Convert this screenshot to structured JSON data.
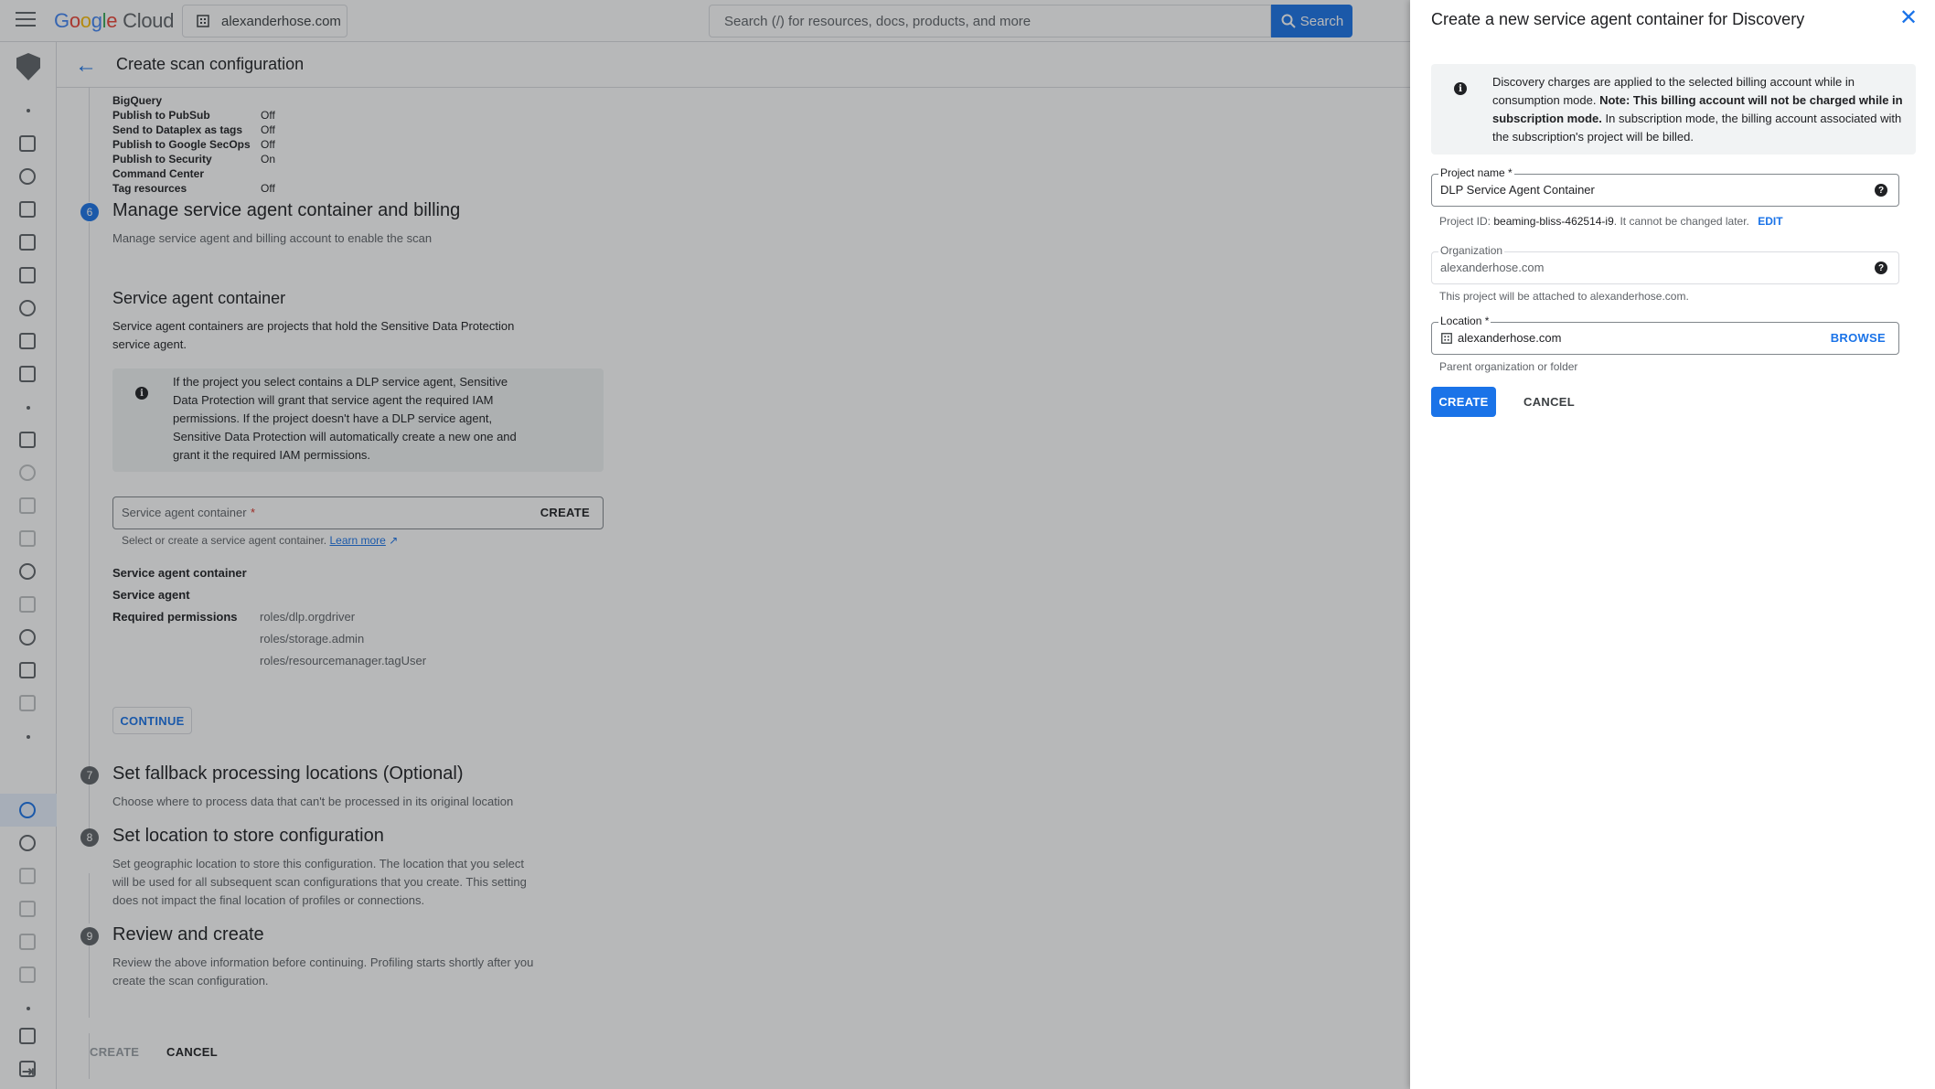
{
  "topbar": {
    "logo_letters": [
      "G",
      "o",
      "o",
      "g",
      "l",
      "e"
    ],
    "logo_cloud": "Cloud",
    "project": "alexanderhose.com",
    "search_placeholder": "Search (/) for resources, docs, products, and more",
    "search_button": "Search"
  },
  "subheader": {
    "title": "Create scan configuration"
  },
  "summary": {
    "partial_label": "BigQuery",
    "rows": [
      {
        "label": "Publish to PubSub",
        "value": "Off"
      },
      {
        "label": "Send to Dataplex as tags",
        "value": "Off"
      },
      {
        "label": "Publish to Google SecOps",
        "value": "Off"
      },
      {
        "label": "Publish to Security",
        "value": "On"
      },
      {
        "label": "Command Center",
        "value": ""
      },
      {
        "label": "Tag resources",
        "value": "Off"
      }
    ]
  },
  "step6": {
    "num": "6",
    "title": "Manage service agent container and billing",
    "desc": "Manage service agent and billing account to enable the scan",
    "section_title": "Service agent container",
    "section_text_1": "Service agent containers are projects that hold the Sensitive Data Protection",
    "section_text_2": "service agent.",
    "info_lines": [
      "If the project you select contains a DLP service agent, Sensitive",
      "Data Protection will grant that service agent the required IAM",
      "permissions. If the project doesn't have a DLP service agent,",
      "Sensitive Data Protection will automatically create a new one and",
      "grant it the required IAM permissions."
    ],
    "field_placeholder": "Service agent container",
    "field_required": "*",
    "field_create": "CREATE",
    "hint_text": "Select or create a service agent container.",
    "learn_more": "Learn more",
    "details": {
      "container_label": "Service agent container",
      "agent_label": "Service agent",
      "permissions_label": "Required permissions",
      "permissions": [
        "roles/dlp.orgdriver",
        "roles/storage.admin",
        "roles/resourcemanager.tagUser"
      ]
    },
    "continue": "CONTINUE"
  },
  "step7": {
    "num": "7",
    "title": "Set fallback processing locations (Optional)",
    "desc": "Choose where to process data that can't be processed in its original location"
  },
  "step8": {
    "num": "8",
    "title": "Set location to store configuration",
    "desc_lines": [
      "Set geographic location to store this configuration. The location that you select",
      "will be used for all subsequent scan configurations that you create. This setting",
      "does not impact the final location of profiles or connections."
    ]
  },
  "step9": {
    "num": "9",
    "title": "Review and create",
    "desc_lines": [
      "Review the above information before continuing. Profiling starts shortly after you",
      "create the scan configuration."
    ]
  },
  "footer": {
    "create": "CREATE",
    "cancel": "CANCEL"
  },
  "panel": {
    "title": "Create a new service agent container for Discovery",
    "info_lines": [
      {
        "plain": "Discovery charges are applied to the selected billing account while in",
        "bold": ""
      },
      {
        "plain": "consumption mode. ",
        "bold": "Note: This billing account will not be charged while in"
      },
      {
        "plain": " In subscription mode, the billing account associated with",
        "bold": "subscription mode.",
        "bold_first": true
      },
      {
        "plain": "the subscription's project will be billed.",
        "bold": ""
      }
    ],
    "project_name_label": "Project name *",
    "project_name_value": "DLP Service Agent Container",
    "project_id_prefix": "Project ID:",
    "project_id": "beaming-bliss-462514-i9",
    "project_id_suffix": ". It cannot be changed later.",
    "edit": "EDIT",
    "organization_label": "Organization",
    "organization_value": "alexanderhose.com",
    "organization_hint": "This project will be attached to alexanderhose.com.",
    "location_label": "Location *",
    "location_value": "alexanderhose.com",
    "browse": "BROWSE",
    "location_hint": "Parent organization or folder",
    "create": "CREATE",
    "cancel": "CANCEL"
  },
  "colors": {
    "primary": "#1a73e8",
    "scrim": "rgba(32,33,36,0.32)"
  },
  "icons": [
    "menu-icon",
    "organization-icon",
    "search-icon",
    "back-arrow-icon",
    "info-icon",
    "help-icon",
    "close-icon",
    "external-link-icon"
  ]
}
